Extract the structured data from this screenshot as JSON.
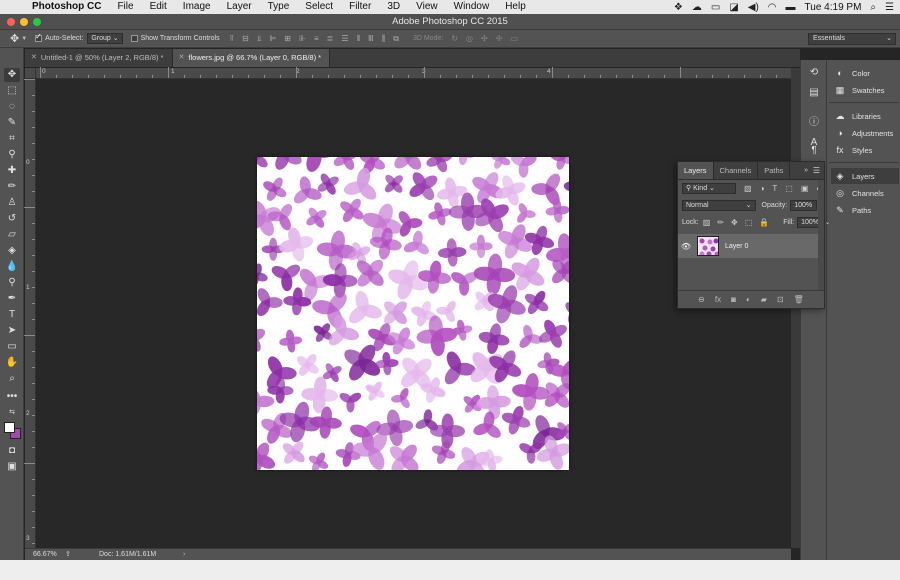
{
  "menubar": {
    "apple_glyph": "",
    "app_name": "Photoshop CC",
    "items": [
      "File",
      "Edit",
      "Image",
      "Layer",
      "Type",
      "Select",
      "Filter",
      "3D",
      "View",
      "Window",
      "Help"
    ],
    "clock": "Tue 4:19 PM",
    "status_icons": [
      "dropbox-icon",
      "creative-cloud-icon",
      "cast-icon",
      "photoshop-status-icon",
      "volume-icon",
      "wifi-icon",
      "battery-icon",
      "search-icon",
      "list-icon"
    ]
  },
  "window": {
    "title": "Adobe Photoshop CC 2015"
  },
  "options_bar": {
    "auto_select_label": "Auto-Select:",
    "auto_select_checked": true,
    "auto_select_value": "Group",
    "show_transform_label": "Show Transform Controls",
    "show_transform_checked": false,
    "mode_3d_label": "3D Mode:",
    "workspace": "Essentials"
  },
  "tabs": [
    {
      "label": "Untitled-1 @ 50% (Layer 2, RGB/8) *",
      "active": false
    },
    {
      "label": "flowers.jpg @ 66.7% (Layer 0, RGB/8) *",
      "active": true
    }
  ],
  "ruler": {
    "h_labels": [
      "0",
      "1",
      "2",
      "3",
      "4"
    ],
    "v_labels": [
      "0",
      "1",
      "2",
      "3"
    ]
  },
  "status": {
    "zoom": "66.67%",
    "doc": "Doc: 1.61M/1.61M"
  },
  "right_dock": {
    "group1": [
      {
        "label": "Color",
        "icon": "color-wheel-icon"
      },
      {
        "label": "Swatches",
        "icon": "swatches-grid-icon"
      }
    ],
    "group2": [
      {
        "label": "Libraries",
        "icon": "libraries-icon"
      },
      {
        "label": "Adjustments",
        "icon": "adjustments-icon"
      },
      {
        "label": "Styles",
        "icon": "styles-icon"
      }
    ],
    "group3": [
      {
        "label": "Layers",
        "icon": "layers-icon",
        "active": true
      },
      {
        "label": "Channels",
        "icon": "channels-icon"
      },
      {
        "label": "Paths",
        "icon": "paths-icon"
      }
    ]
  },
  "layers_panel": {
    "tabs": [
      "Layers",
      "Channels",
      "Paths"
    ],
    "active_tab": "Layers",
    "filter": "Kind",
    "blend_mode": "Normal",
    "opacity_label": "Opacity:",
    "opacity_value": "100%",
    "lock_label": "Lock:",
    "fill_label": "Fill:",
    "fill_value": "100%",
    "layers": [
      {
        "name": "Layer 0",
        "visible": true
      }
    ]
  },
  "colors": {
    "foreground": "#ffffff",
    "background": "#a447ae",
    "accent_purple": "#9b3fb0"
  }
}
